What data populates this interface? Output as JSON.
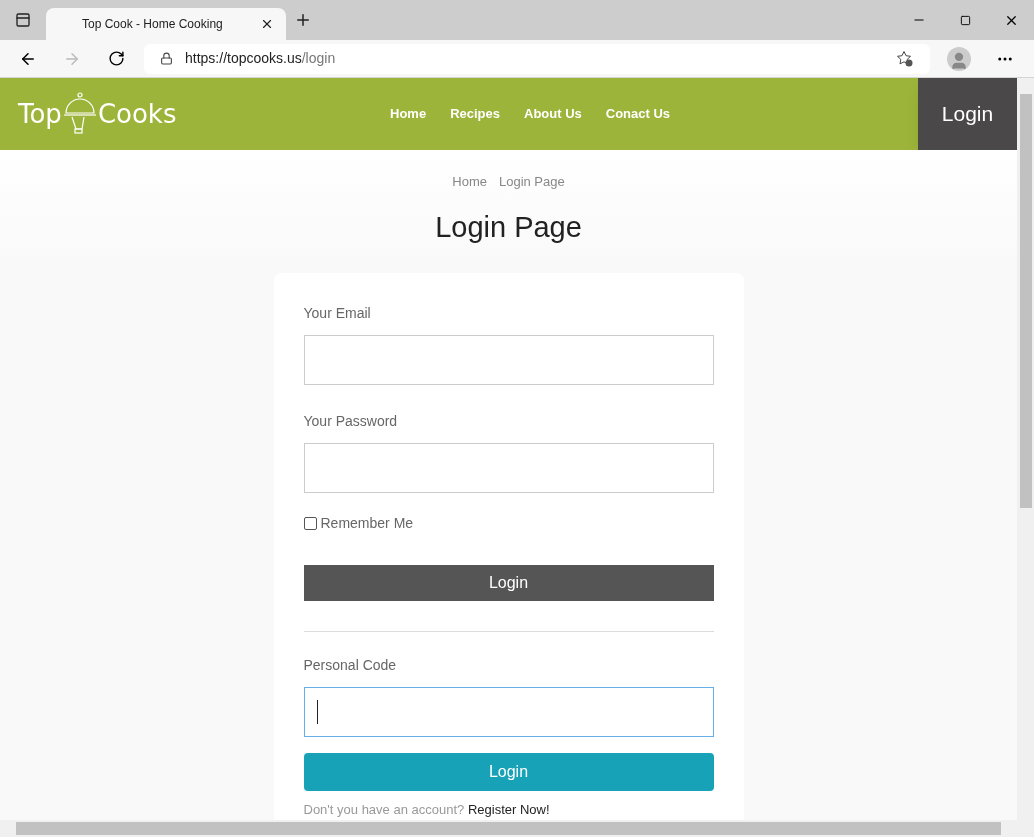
{
  "browser": {
    "tab_title": "Top Cook - Home Cooking",
    "url_host": "https://topcooks.us",
    "url_path": "/login"
  },
  "header": {
    "logo_left": "Top",
    "logo_right": "Cooks",
    "nav": [
      {
        "label": "Home"
      },
      {
        "label": "Recipes"
      },
      {
        "label": "About Us"
      },
      {
        "label": "Conact Us"
      }
    ],
    "login_button": "Login"
  },
  "breadcrumb": [
    "Home",
    "Login Page"
  ],
  "title": "Login Page",
  "form": {
    "email_label": "Your Email",
    "password_label": "Your Password",
    "remember": {
      "label": "Remember Me",
      "checked": false
    },
    "login_button": "Login",
    "code_label": "Personal Code",
    "code_focused": true,
    "code_button": "Login",
    "footer_text": "Don't you have an account?",
    "footer_link": "Register Now!"
  }
}
